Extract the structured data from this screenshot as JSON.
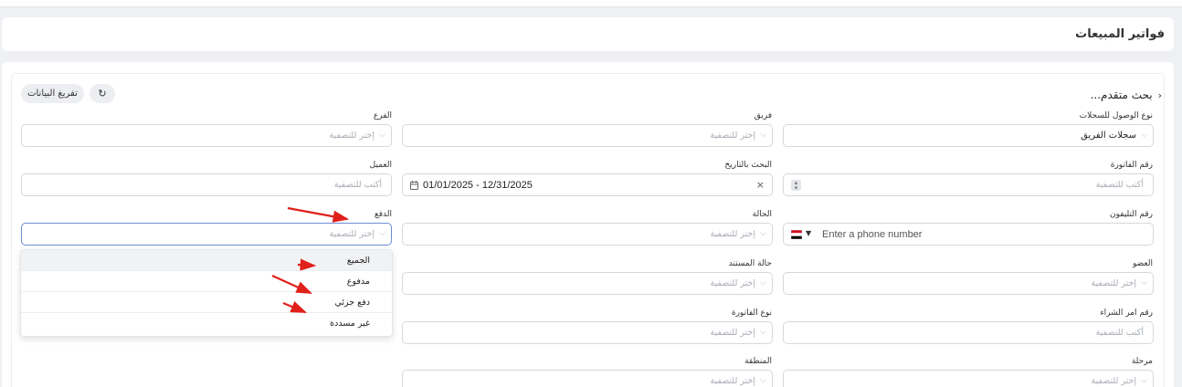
{
  "page": {
    "title": "فواتير المبيعات"
  },
  "toolbar": {
    "advanced_search": "بحث متقدم...",
    "clear_label": "تفريغ البيانات"
  },
  "filters": {
    "access_type": {
      "label": "نوع الوصول للسجلات",
      "value": "سجلات الفريق"
    },
    "team": {
      "label": "فريق",
      "placeholder": "إختر للتصفية"
    },
    "branch": {
      "label": "الفرع",
      "placeholder": "إختر للتصفية"
    },
    "invoice_number": {
      "label": "رقم الفاتورة",
      "placeholder": "أكتب للتصفية"
    },
    "date_search": {
      "label": "البحث بالتاريخ",
      "value": "01/01/2025 - 12/31/2025"
    },
    "customer": {
      "label": "العميل",
      "placeholder": "أكتب للتصفية"
    },
    "phone": {
      "label": "رقم التليفون",
      "placeholder": "Enter a phone number"
    },
    "status": {
      "label": "الحالة",
      "placeholder": "إختر للتصفية"
    },
    "payment": {
      "label": "الدفع",
      "placeholder": "إختر للتصفية"
    },
    "member": {
      "label": "العضو",
      "placeholder": "إختر للتصفية"
    },
    "document_status": {
      "label": "حالة المستند",
      "placeholder": "إختر للتصفية"
    },
    "purchase_order": {
      "label": "رقم امر الشراء",
      "placeholder": "أكتب للتصفية"
    },
    "invoice_type": {
      "label": "نوع الفاتورة",
      "placeholder": "إختر للتصفية"
    },
    "stage": {
      "label": "مرحلة",
      "placeholder": "إختر للتصفية"
    },
    "region": {
      "label": "المنطقة",
      "placeholder": "إختر للتصفية"
    }
  },
  "payment_dropdown": {
    "options": [
      "الجميع",
      "مدفوع",
      "دفع جزئي",
      "غير مسددة"
    ],
    "selected": "الجميع"
  },
  "colors": {
    "annotation_arrow": "#e0201b",
    "focus_border": "#6b8cd4"
  }
}
